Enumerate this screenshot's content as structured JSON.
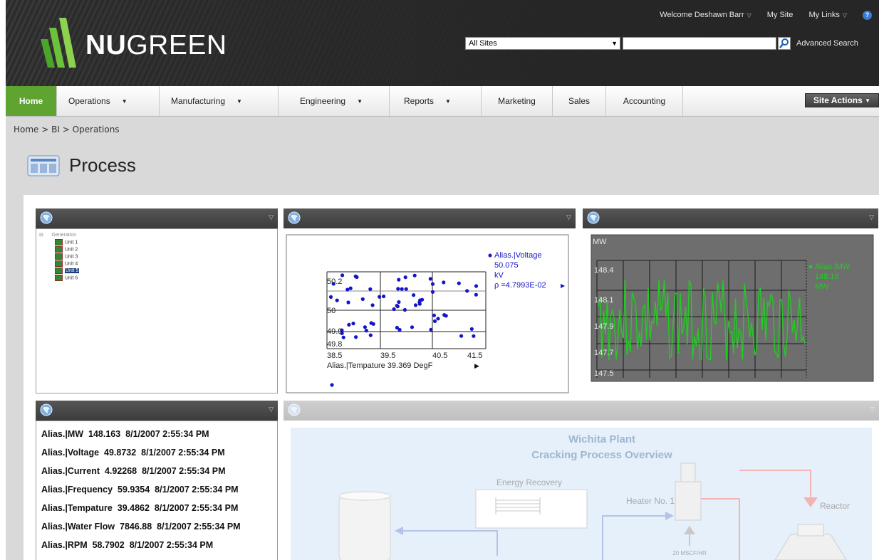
{
  "brand": {
    "name_bold": "NU",
    "name_rest": "GREEN"
  },
  "toplinks": {
    "welcome": "Welcome Deshawn Barr",
    "my_site": "My Site",
    "my_links": "My Links"
  },
  "search": {
    "scope": "All Sites",
    "query": "",
    "advanced": "Advanced Search"
  },
  "nav": {
    "items": [
      {
        "label": "Home",
        "active": true,
        "dropdown": false
      },
      {
        "label": "Operations",
        "dropdown": true
      },
      {
        "label": "Manufacturing",
        "dropdown": true
      },
      {
        "label": "Engineering",
        "dropdown": true
      },
      {
        "label": "Reports",
        "dropdown": true
      },
      {
        "label": "Marketing",
        "dropdown": false
      },
      {
        "label": "Sales",
        "dropdown": false
      },
      {
        "label": "Accounting",
        "dropdown": false
      }
    ],
    "site_actions": "Site Actions"
  },
  "breadcrumb": "Home > BI > Operations",
  "page_title": "Process",
  "tree": {
    "root": "Generation",
    "items": [
      "Unit 1",
      "Unit 2",
      "Unit 3",
      "Unit 4",
      "Unit 5",
      "Unit 6"
    ],
    "selected": "Unit 5"
  },
  "scatter": {
    "y_ticks": [
      "50.2",
      "50",
      "49.9",
      "49.8"
    ],
    "x_ticks": [
      "38.5",
      "39.5",
      "40.5",
      "41.5"
    ],
    "x_label": "Alias.|Tempature 39.369  DegF",
    "legend": {
      "name": "Alias.|Voltage",
      "value": "50.075",
      "unit": "kV",
      "rho": "ρ =4.7993E-02"
    }
  },
  "trend": {
    "unit": "MW",
    "y_ticks": [
      "148.4",
      "148.1",
      "147.9",
      "147.7",
      "147.5"
    ],
    "legend": {
      "name": "Alias.|MW",
      "value": "148.16",
      "unit": "MW"
    }
  },
  "values_list": [
    {
      "name": "Alias.|MW",
      "value": "148.163",
      "time": "8/1/2007 2:55:34 PM"
    },
    {
      "name": "Alias.|Voltage",
      "value": "49.8732",
      "time": "8/1/2007 2:55:34 PM"
    },
    {
      "name": "Alias.|Current",
      "value": "4.92268",
      "time": "8/1/2007 2:55:34 PM"
    },
    {
      "name": "Alias.|Frequency",
      "value": "59.9354",
      "time": "8/1/2007 2:55:34 PM"
    },
    {
      "name": "Alias.|Tempature",
      "value": "39.4862",
      "time": "8/1/2007 2:55:34 PM"
    },
    {
      "name": "Alias.|Water Flow",
      "value": "7846.88",
      "time": "8/1/2007 2:55:34 PM"
    },
    {
      "name": "Alias.|RPM",
      "value": "58.7902",
      "time": "8/1/2007 2:55:34 PM"
    }
  ],
  "diagram": {
    "title1": "Wichita Plant",
    "title2": "Cracking Process Overview",
    "energy": "Energy Recovery",
    "heater": "Heater No. 1",
    "reactor": "Reactor",
    "flow": "20 MSCF/HR"
  },
  "colors": {
    "accent": "#5fa431",
    "scatter": "#1515c8",
    "trend_line": "#22cc22",
    "trend_bg": "#6e6e6e"
  }
}
